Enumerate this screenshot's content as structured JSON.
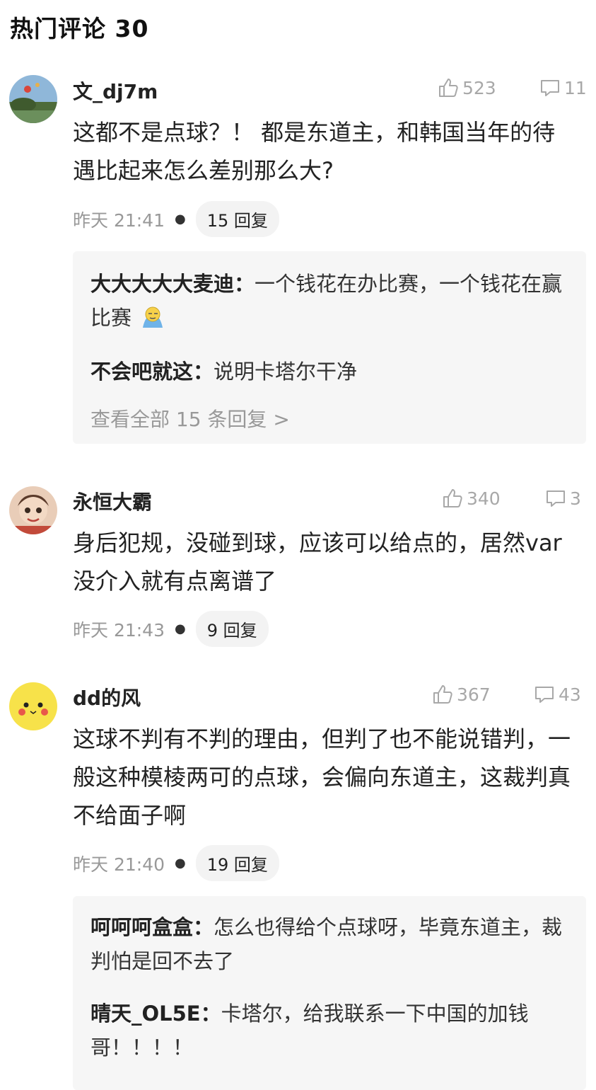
{
  "header": {
    "title": "热门评论 30"
  },
  "comments": [
    {
      "user": "文_dj7m",
      "likes": "523",
      "replies_count": "11",
      "text": "这都不是点球？！ 都是东道主，和韩国当年的待遇比起来怎么差别那么大?",
      "time": "昨天 21:41",
      "reply_label": "15 回复",
      "sub_replies": [
        {
          "user": "大大大大大麦迪：",
          "text": "一个钱花在办比赛，一个钱花在赢比赛",
          "emoji": "doge-emoji"
        },
        {
          "user": "不会吧就这：",
          "text": "说明卡塔尔干净"
        }
      ],
      "view_all": "查看全部 15 条回复 >"
    },
    {
      "user": "永恒大霸",
      "likes": "340",
      "replies_count": "3",
      "text": "身后犯规，没碰到球，应该可以给点的，居然var没介入就有点离谱了",
      "time": "昨天 21:43",
      "reply_label": "9 回复"
    },
    {
      "user": "dd的风",
      "likes": "367",
      "replies_count": "43",
      "text": "这球不判有不判的理由，但判了也不能说错判，一般这种模棱两可的点球，会偏向东道主，这裁判真不给面子啊",
      "time": "昨天 21:40",
      "reply_label": "19 回复",
      "sub_replies": [
        {
          "user": "呵呵呵盒盒：",
          "text": "怎么也得给个点球呀，毕竟东道主，裁判怕是回不去了"
        },
        {
          "user": "晴天_OL5E：",
          "text": "卡塔尔，给我联系一下中国的加钱哥！！！！"
        }
      ]
    }
  ],
  "icons": {
    "like": "thumbs-up-icon",
    "reply": "comment-icon"
  },
  "colors": {
    "muted": "#a8a8a8",
    "reply_bg": "#f6f6f6",
    "pill_bg": "#f3f3f3"
  }
}
